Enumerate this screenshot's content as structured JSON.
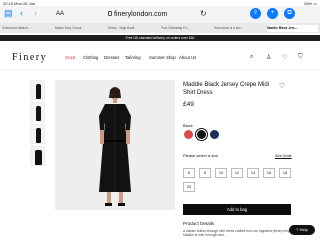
{
  "status": {
    "time": "22:15",
    "date": "Mon 26 Jun",
    "battery": "26%"
  },
  "browser": {
    "aa": "AA",
    "url": "finerylondon.com",
    "tabs": [
      "3 bedroom detach...",
      "Marks Dory Colour...",
      "Dress - Yoga Knoll...",
      "Polo Giveaway Fo...",
      "How much is a sec...",
      "Maddie Black Jers..."
    ]
  },
  "promo": "Free UK standard delivery on orders over £60",
  "header": {
    "logo": "Finery",
    "nav": [
      "SALE",
      "Clothing",
      "Dresses",
      "Tailoring",
      "Summer Shop",
      "About Us"
    ]
  },
  "product": {
    "title": "Maddie Black Jersey Crepe Midi Shirt Dress",
    "price": "£49",
    "colour_label": "Black",
    "colours": [
      "#d94a4a",
      "#111111",
      "#1f2d55"
    ],
    "size_label": "Please select a size",
    "size_guide": "Size Guide",
    "sizes": [
      "6",
      "8",
      "10",
      "12",
      "14",
      "16",
      "18",
      "20"
    ],
    "add_to_bag": "Add to bag",
    "details_heading": "Product Details",
    "description": "A classic button-through skirt dress crafted from our signature jersey crepe. Maddie is midi in length and..."
  },
  "help": "Help"
}
